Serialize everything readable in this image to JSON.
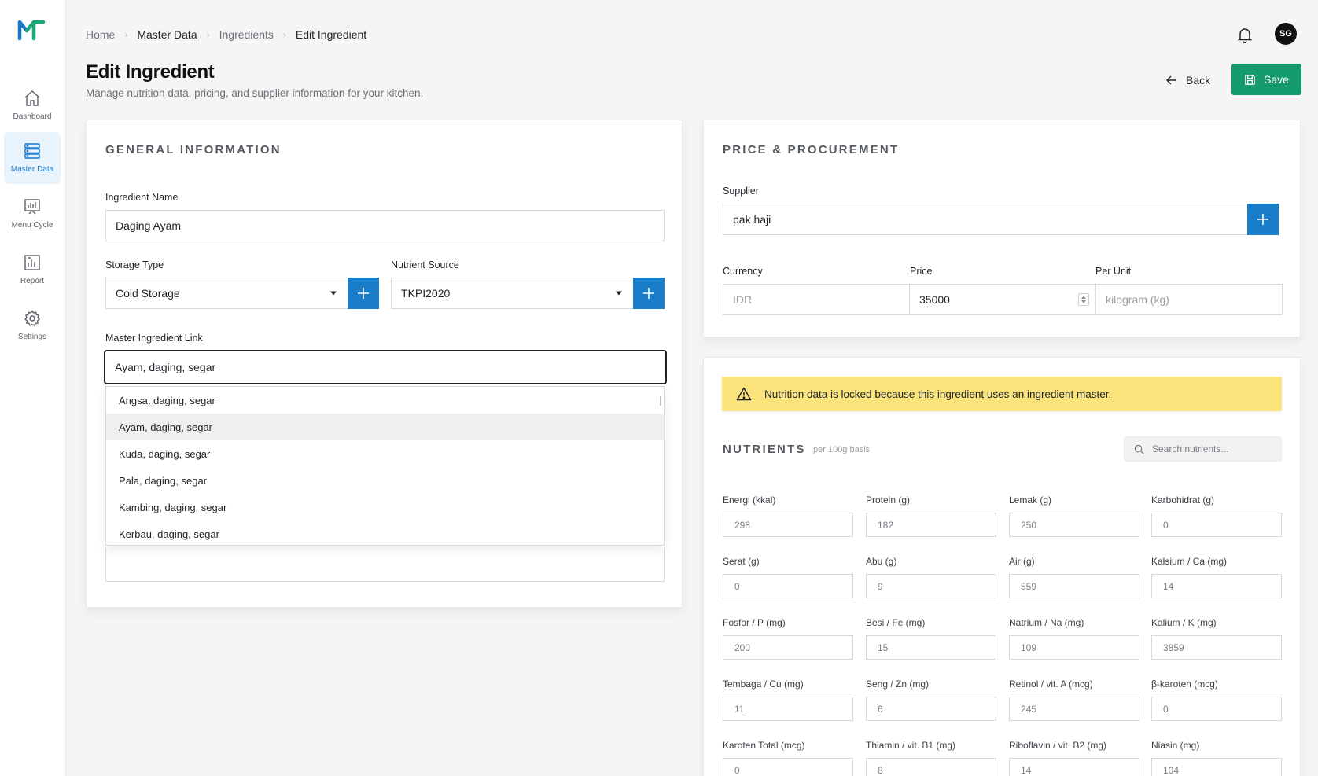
{
  "colors": {
    "accent": "#1a7dc7",
    "save": "#139a6d",
    "alert": "#fbe37b"
  },
  "sidebar": {
    "items": [
      {
        "label": "Dashboard",
        "icon": "home-icon"
      },
      {
        "label": "Master Data",
        "icon": "database-icon",
        "active": true
      },
      {
        "label": "Menu Cycle",
        "icon": "chart-board-icon"
      },
      {
        "label": "Report",
        "icon": "report-icon"
      },
      {
        "label": "Settings",
        "icon": "gear-icon"
      }
    ]
  },
  "header": {
    "breadcrumb": [
      "Home",
      "Master Data",
      "Ingredients",
      "Edit Ingredient"
    ],
    "avatar": "SG",
    "title": "Edit Ingredient",
    "subtitle": "Manage nutrition data, pricing, and supplier information for your kitchen.",
    "back_label": "Back",
    "save_label": "Save"
  },
  "general": {
    "title": "GENERAL INFORMATION",
    "name_label": "Ingredient Name",
    "name_value": "Daging Ayam",
    "storage_label": "Storage Type",
    "storage_value": "Cold Storage",
    "source_label": "Nutrient Source",
    "source_value": "TKPI2020",
    "master_label": "Master Ingredient Link",
    "master_value": "Ayam, daging, segar",
    "options": [
      "Angsa, daging, segar",
      "Ayam, daging, segar",
      "Kuda, daging, segar",
      "Pala, daging, segar",
      "Kambing, daging, segar",
      "Kerbau, daging, segar"
    ],
    "selected_option": 1
  },
  "price": {
    "title": "PRICE & PROCUREMENT",
    "supplier_label": "Supplier",
    "supplier_value": "pak haji",
    "currency_label": "Currency",
    "currency_value": "IDR",
    "price_label": "Price",
    "price_value": "35000",
    "unit_label": "Per Unit",
    "unit_value": "kilogram (kg)"
  },
  "nutrition": {
    "alert": "Nutrition data is locked because this ingredient uses an ingredient master.",
    "title": "NUTRIENTS",
    "basis": "per 100g basis",
    "search_placeholder": "Search nutrients...",
    "items": [
      {
        "label": "Energi (kkal)",
        "value": "298"
      },
      {
        "label": "Protein (g)",
        "value": "182"
      },
      {
        "label": "Lemak (g)",
        "value": "250"
      },
      {
        "label": "Karbohidrat (g)",
        "value": "0"
      },
      {
        "label": "Serat (g)",
        "value": "0"
      },
      {
        "label": "Abu (g)",
        "value": "9"
      },
      {
        "label": "Air (g)",
        "value": "559"
      },
      {
        "label": "Kalsium / Ca (mg)",
        "value": "14"
      },
      {
        "label": "Fosfor / P (mg)",
        "value": "200"
      },
      {
        "label": "Besi / Fe (mg)",
        "value": "15"
      },
      {
        "label": "Natrium / Na (mg)",
        "value": "109"
      },
      {
        "label": "Kalium / K (mg)",
        "value": "3859"
      },
      {
        "label": "Tembaga / Cu (mg)",
        "value": "11"
      },
      {
        "label": "Seng / Zn (mg)",
        "value": "6"
      },
      {
        "label": "Retinol / vit. A (mcg)",
        "value": "245"
      },
      {
        "label": "β-karoten (mcg)",
        "value": "0"
      },
      {
        "label": "Karoten Total (mcg)",
        "value": "0"
      },
      {
        "label": "Thiamin / vit. B1 (mg)",
        "value": "8"
      },
      {
        "label": "Riboflavin / vit. B2 (mg)",
        "value": "14"
      },
      {
        "label": "Niasin (mg)",
        "value": "104"
      }
    ]
  }
}
